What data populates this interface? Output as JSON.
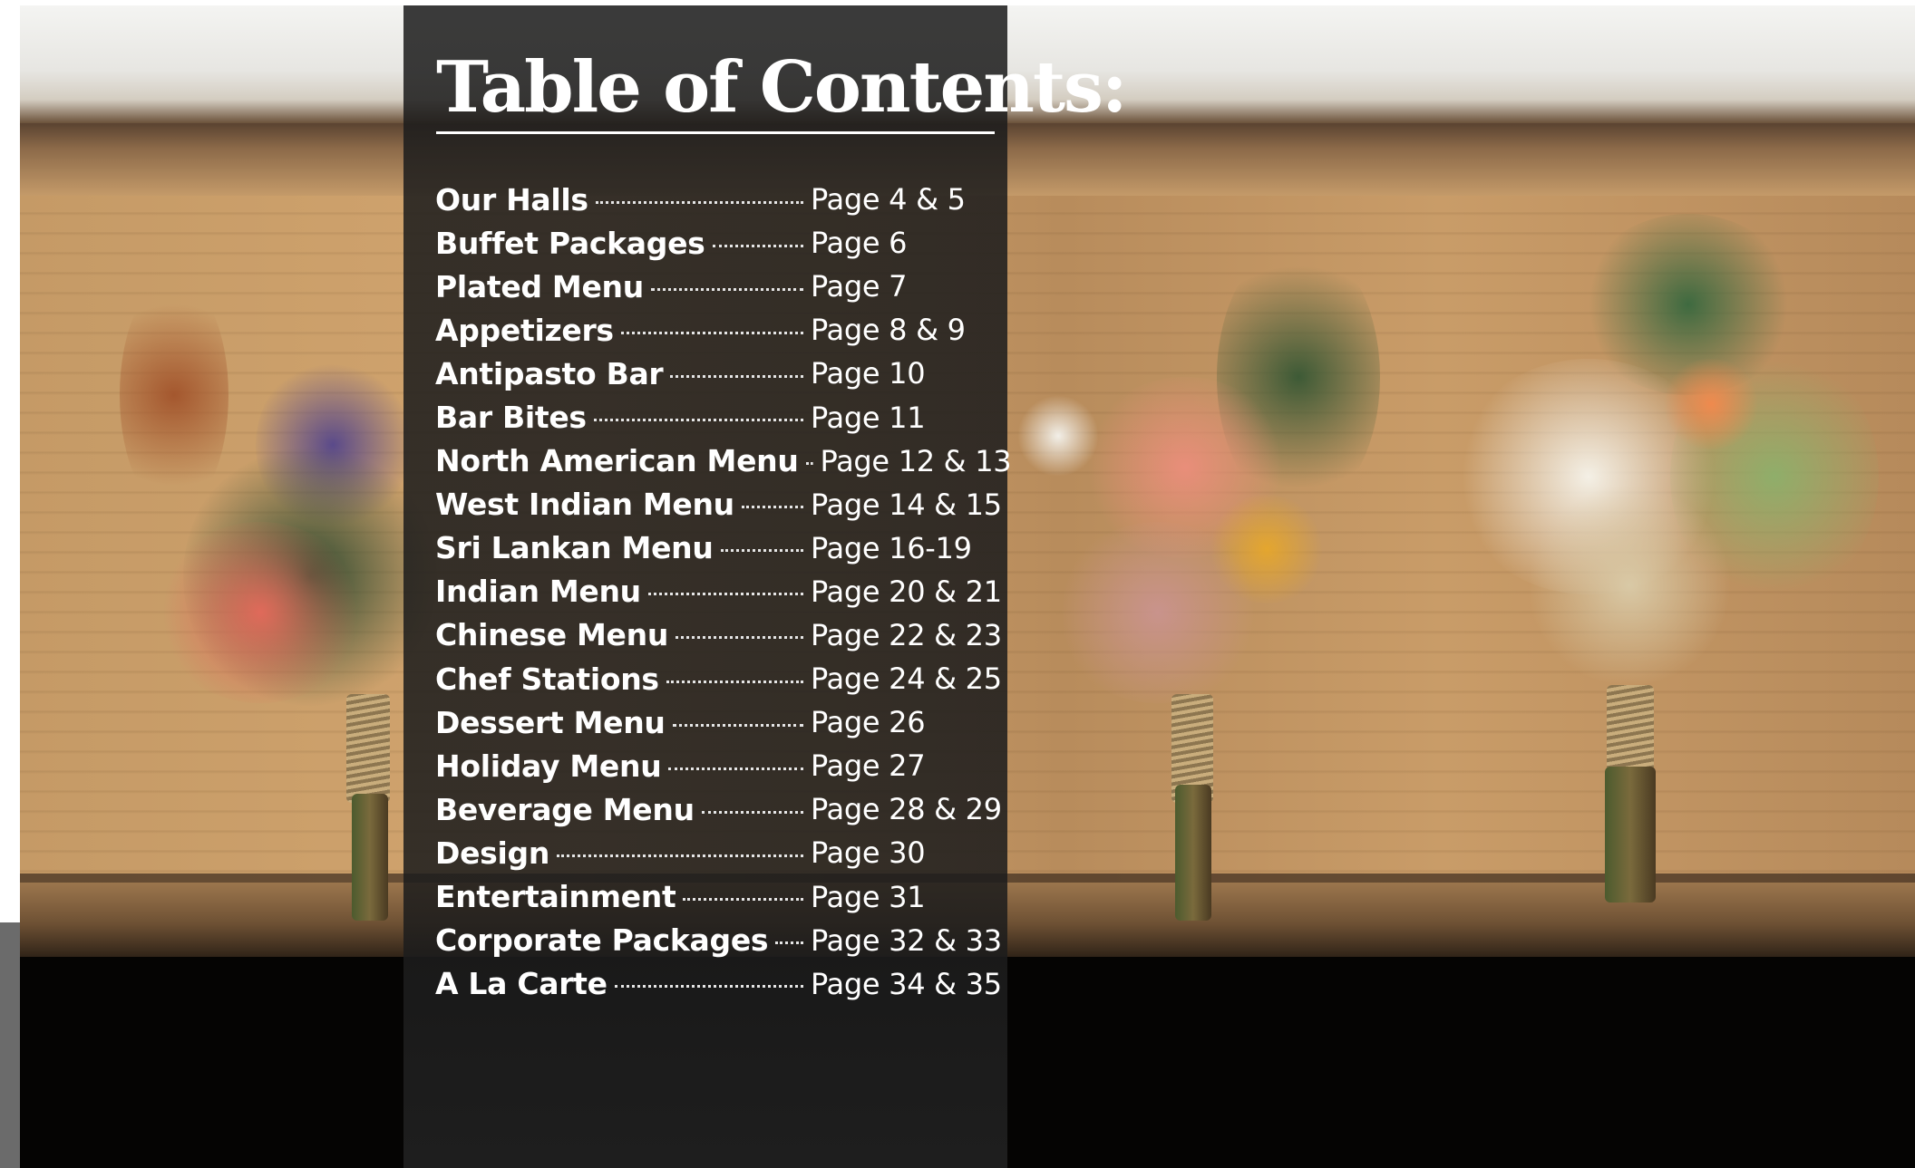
{
  "toc": {
    "title": "Table of Contents:",
    "entries": [
      {
        "label": "Our Halls",
        "page": "Page 4 & 5"
      },
      {
        "label": "Buffet Packages",
        "page": "Page 6"
      },
      {
        "label": "Plated Menu",
        "page": "Page 7"
      },
      {
        "label": "Appetizers",
        "page": "Page 8 & 9"
      },
      {
        "label": "Antipasto Bar",
        "page": "Page 10"
      },
      {
        "label": "Bar Bites",
        "page": "Page 11"
      },
      {
        "label": "North American Menu",
        "page": "Page 12 & 13"
      },
      {
        "label": "West Indian Menu",
        "page": "Page 14 & 15"
      },
      {
        "label": "Sri Lankan Menu",
        "page": "Page 16-19"
      },
      {
        "label": "Indian Menu",
        "page": "Page 20 & 21"
      },
      {
        "label": "Chinese Menu",
        "page": "Page 22 & 23"
      },
      {
        "label": "Chef Stations",
        "page": "Page 24 & 25"
      },
      {
        "label": "Dessert Menu",
        "page": "Page 26"
      },
      {
        "label": "Holiday Menu",
        "page": "Page 27"
      },
      {
        "label": "Beverage Menu",
        "page": "Page 28 & 29"
      },
      {
        "label": "Design",
        "page": "Page 30"
      },
      {
        "label": "Entertainment",
        "page": "Page 31"
      },
      {
        "label": "Corporate Packages",
        "page": "Page 32 & 33"
      },
      {
        "label": "A La Carte",
        "page": "Page 34 & 35"
      }
    ]
  },
  "colors": {
    "panel": "#1c1c1c",
    "text": "#ffffff",
    "wood": "#c59a66"
  }
}
